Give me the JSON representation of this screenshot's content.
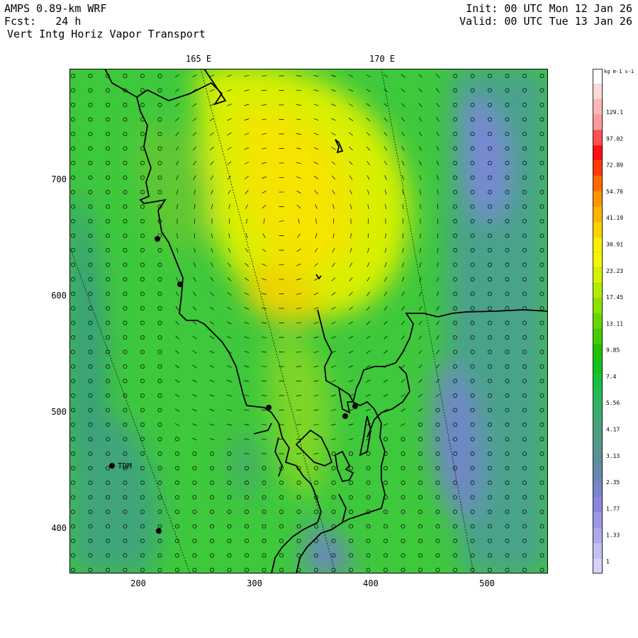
{
  "header": {
    "model": "AMPS 0.89-km WRF",
    "forecast": "Fcst:   24 h",
    "field": "Vert Intg Horiz Vapor Transport",
    "init": "Init: 00 UTC Mon 12 Jan 26",
    "valid": "Valid: 00 UTC Tue 13 Jan 26"
  },
  "map": {
    "lon_labels": [
      "165 E",
      "170 E"
    ],
    "y_ticks": [
      "700",
      "600",
      "500",
      "400"
    ],
    "x_ticks": [
      "200",
      "300",
      "400",
      "500"
    ],
    "stations": [
      {
        "label": "TDM"
      }
    ]
  },
  "colorbar": {
    "units": "kg m-1 s-1",
    "labels": [
      "129.1",
      "97.02",
      "72.89",
      "54.76",
      "41.19",
      "30.91",
      "23.23",
      "17.45",
      "13.11",
      "9.85",
      "7.4",
      "5.56",
      "4.17",
      "3.13",
      "2.35",
      "1.77",
      "1.33",
      "1"
    ],
    "colors": [
      "#ffffff",
      "#ffd8d8",
      "#ffb8b8",
      "#ff9a9a",
      "#ff5050",
      "#ff1010",
      "#ff3a00",
      "#ff6a00",
      "#ff9400",
      "#ffb400",
      "#ffd200",
      "#ffee00",
      "#f2f700",
      "#d4f200",
      "#b2ec00",
      "#8ce200",
      "#66d800",
      "#44cc00",
      "#22c000",
      "#10c21e",
      "#18c040",
      "#2ab85a",
      "#3aac6c",
      "#48a07c",
      "#54988a",
      "#5e8e98",
      "#6a88ac",
      "#7a84c6",
      "#8a86dc",
      "#9c98e6",
      "#aeaaea",
      "#c2c0f0",
      "#d6d4f6"
    ]
  }
}
